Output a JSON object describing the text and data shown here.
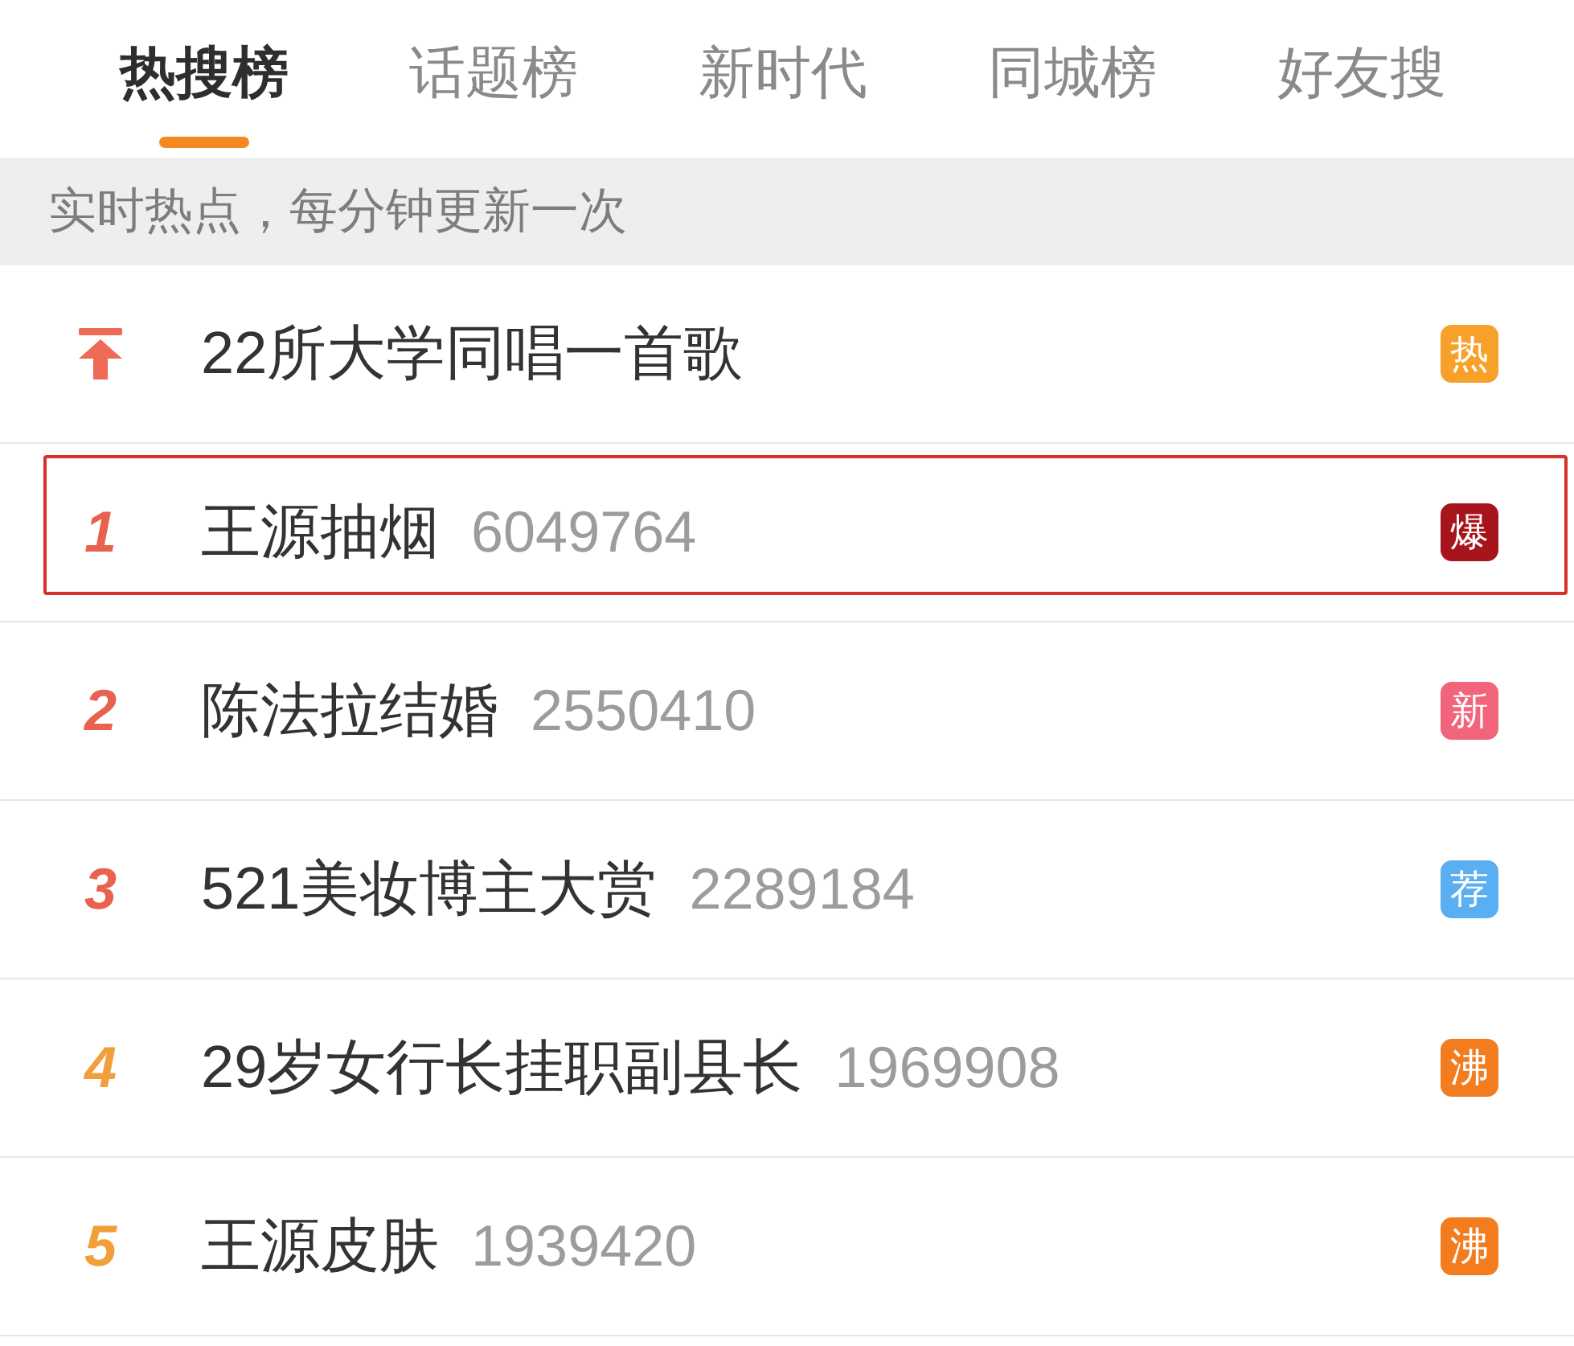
{
  "tabs": [
    {
      "label": "热搜榜",
      "selected": true
    },
    {
      "label": "话题榜",
      "selected": false
    },
    {
      "label": "新时代",
      "selected": false
    },
    {
      "label": "同城榜",
      "selected": false
    },
    {
      "label": "好友搜",
      "selected": false
    }
  ],
  "notice": "实时热点，每分钟更新一次",
  "rows": [
    {
      "kind": "pinned",
      "rank": {
        "color": "#ec6a56"
      },
      "title": "22所大学同唱一首歌",
      "badge": {
        "label": "热",
        "color": "#f7a12b"
      },
      "highlighted": false
    },
    {
      "kind": "ranked",
      "rank": {
        "label": "1",
        "color": "#e9614f"
      },
      "title": "王源抽烟",
      "count": "6049764",
      "badge": {
        "label": "爆",
        "color": "#a8141b"
      },
      "highlighted": true
    },
    {
      "kind": "ranked",
      "rank": {
        "label": "2",
        "color": "#e9614f"
      },
      "title": "陈法拉结婚",
      "count": "2550410",
      "badge": {
        "label": "新",
        "color": "#f2647b"
      },
      "highlighted": false
    },
    {
      "kind": "ranked",
      "rank": {
        "label": "3",
        "color": "#e9614f"
      },
      "title": "521美妆博主大赏",
      "count": "2289184",
      "badge": {
        "label": "荐",
        "color": "#5aaff2"
      },
      "highlighted": false
    },
    {
      "kind": "ranked",
      "rank": {
        "label": "4",
        "color": "#f0a03a"
      },
      "title": "29岁女行长挂职副县长",
      "count": "1969908",
      "badge": {
        "label": "沸",
        "color": "#f37c1e"
      },
      "highlighted": false
    },
    {
      "kind": "ranked",
      "rank": {
        "label": "5",
        "color": "#f0a03a"
      },
      "title": "王源皮肤",
      "count": "1939420",
      "badge": {
        "label": "沸",
        "color": "#f37c1e"
      },
      "highlighted": false
    }
  ]
}
